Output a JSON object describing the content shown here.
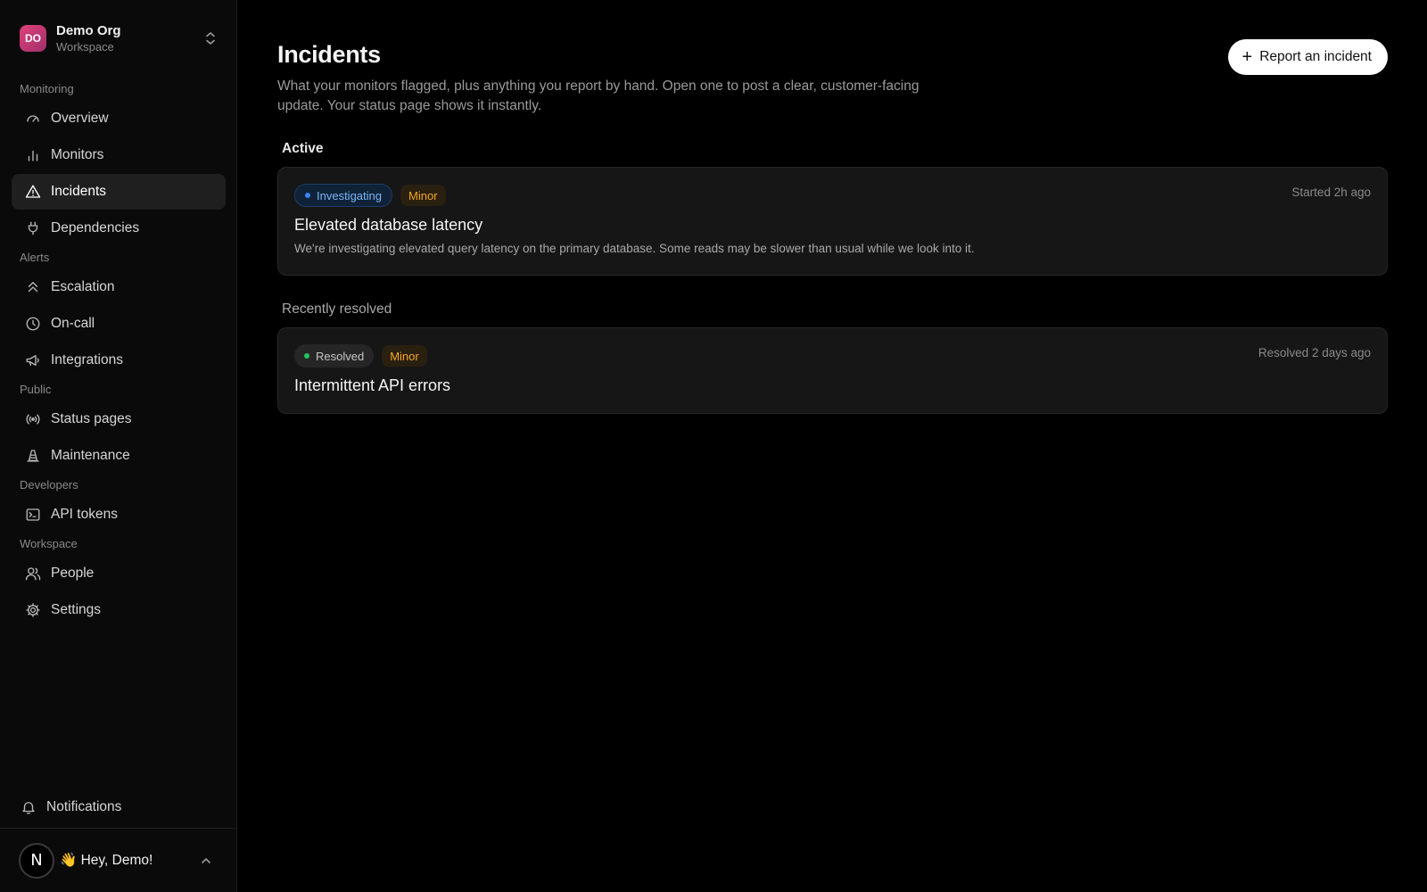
{
  "org": {
    "initials": "DO",
    "name": "Demo Org",
    "subtitle": "Workspace"
  },
  "sidebar": {
    "sections": [
      {
        "label": "Monitoring",
        "items": [
          {
            "label": "Overview",
            "icon": "gauge-icon"
          },
          {
            "label": "Monitors",
            "icon": "bar-chart-icon"
          },
          {
            "label": "Incidents",
            "icon": "warning-triangle-icon",
            "active": true
          },
          {
            "label": "Dependencies",
            "icon": "plug-icon"
          }
        ]
      },
      {
        "label": "Alerts",
        "items": [
          {
            "label": "Escalation",
            "icon": "chevrons-up-icon"
          },
          {
            "label": "On-call",
            "icon": "clock-icon"
          },
          {
            "label": "Integrations",
            "icon": "megaphone-icon"
          }
        ]
      },
      {
        "label": "Public",
        "items": [
          {
            "label": "Status pages",
            "icon": "broadcast-icon"
          },
          {
            "label": "Maintenance",
            "icon": "traffic-cone-icon"
          }
        ]
      },
      {
        "label": "Developers",
        "items": [
          {
            "label": "API tokens",
            "icon": "terminal-icon"
          }
        ]
      },
      {
        "label": "Workspace",
        "items": [
          {
            "label": "People",
            "icon": "users-icon"
          },
          {
            "label": "Settings",
            "icon": "gear-icon"
          }
        ]
      }
    ],
    "notifications_label": "Notifications"
  },
  "user": {
    "avatar_letter": "N",
    "greeting": "👋 Hey, Demo!"
  },
  "main": {
    "title": "Incidents",
    "description": "What your monitors flagged, plus anything you report by hand. Open one to post a clear, customer-facing update. Your status page shows it instantly.",
    "report_button_label": "Report an incident",
    "active_label": "Active",
    "resolved_label": "Recently resolved",
    "active_incidents": [
      {
        "status": "Investigating",
        "severity": "Minor",
        "time": "Started 2h ago",
        "title": "Elevated database latency",
        "body": "We're investigating elevated query latency on the primary database. Some reads may be slower than usual while we look into it."
      }
    ],
    "resolved_incidents": [
      {
        "status": "Resolved",
        "severity": "Minor",
        "time": "Resolved 2 days ago",
        "title": "Intermittent API errors"
      }
    ]
  },
  "colors": {
    "investigating": "#3b82f6",
    "resolved": "#22c55e",
    "minor": "#f5a623"
  }
}
